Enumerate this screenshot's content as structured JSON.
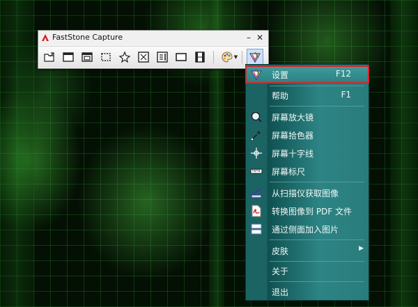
{
  "window": {
    "title": "FastStone Capture",
    "minimize_glyph": "–",
    "close_glyph": "✕"
  },
  "toolbar": {
    "buttons": [
      {
        "name": "open-file-icon"
      },
      {
        "name": "capture-active-window-icon"
      },
      {
        "name": "capture-window-object-icon"
      },
      {
        "name": "capture-rectangle-icon"
      },
      {
        "name": "capture-freehand-icon"
      },
      {
        "name": "capture-fullscreen-icon"
      },
      {
        "name": "capture-scrolling-icon"
      },
      {
        "name": "capture-fixed-region-icon"
      },
      {
        "name": "screen-recorder-icon"
      },
      {
        "name": "output-palette-icon"
      },
      {
        "name": "settings-menu-icon"
      }
    ]
  },
  "menu": {
    "items": [
      {
        "label": "设置",
        "shortcut": "F12",
        "icon": "settings-icon"
      },
      {
        "label": "帮助",
        "shortcut": "F1",
        "icon": ""
      },
      {
        "label": "屏幕放大镜",
        "shortcut": "",
        "icon": "magnifier-icon"
      },
      {
        "label": "屏幕拾色器",
        "shortcut": "",
        "icon": "color-picker-icon"
      },
      {
        "label": "屏幕十字线",
        "shortcut": "",
        "icon": "crosshair-icon"
      },
      {
        "label": "屏幕标尺",
        "shortcut": "",
        "icon": "ruler-icon"
      },
      {
        "label": "从扫描仪获取图像",
        "shortcut": "",
        "icon": "scanner-icon"
      },
      {
        "label": "转换图像到 PDF 文件",
        "shortcut": "",
        "icon": "pdf-icon"
      },
      {
        "label": "通过侧面加入图片",
        "shortcut": "",
        "icon": "join-images-icon"
      },
      {
        "label": "皮肤",
        "shortcut": "",
        "icon": "",
        "arrow": "▶"
      },
      {
        "label": "关于",
        "shortcut": "",
        "icon": ""
      },
      {
        "label": "退出",
        "shortcut": "",
        "icon": ""
      }
    ]
  },
  "colors": {
    "menu_background": "#2a7c7c",
    "highlight_border": "#d8232a",
    "wallpaper_green": "#2e9a2e"
  }
}
